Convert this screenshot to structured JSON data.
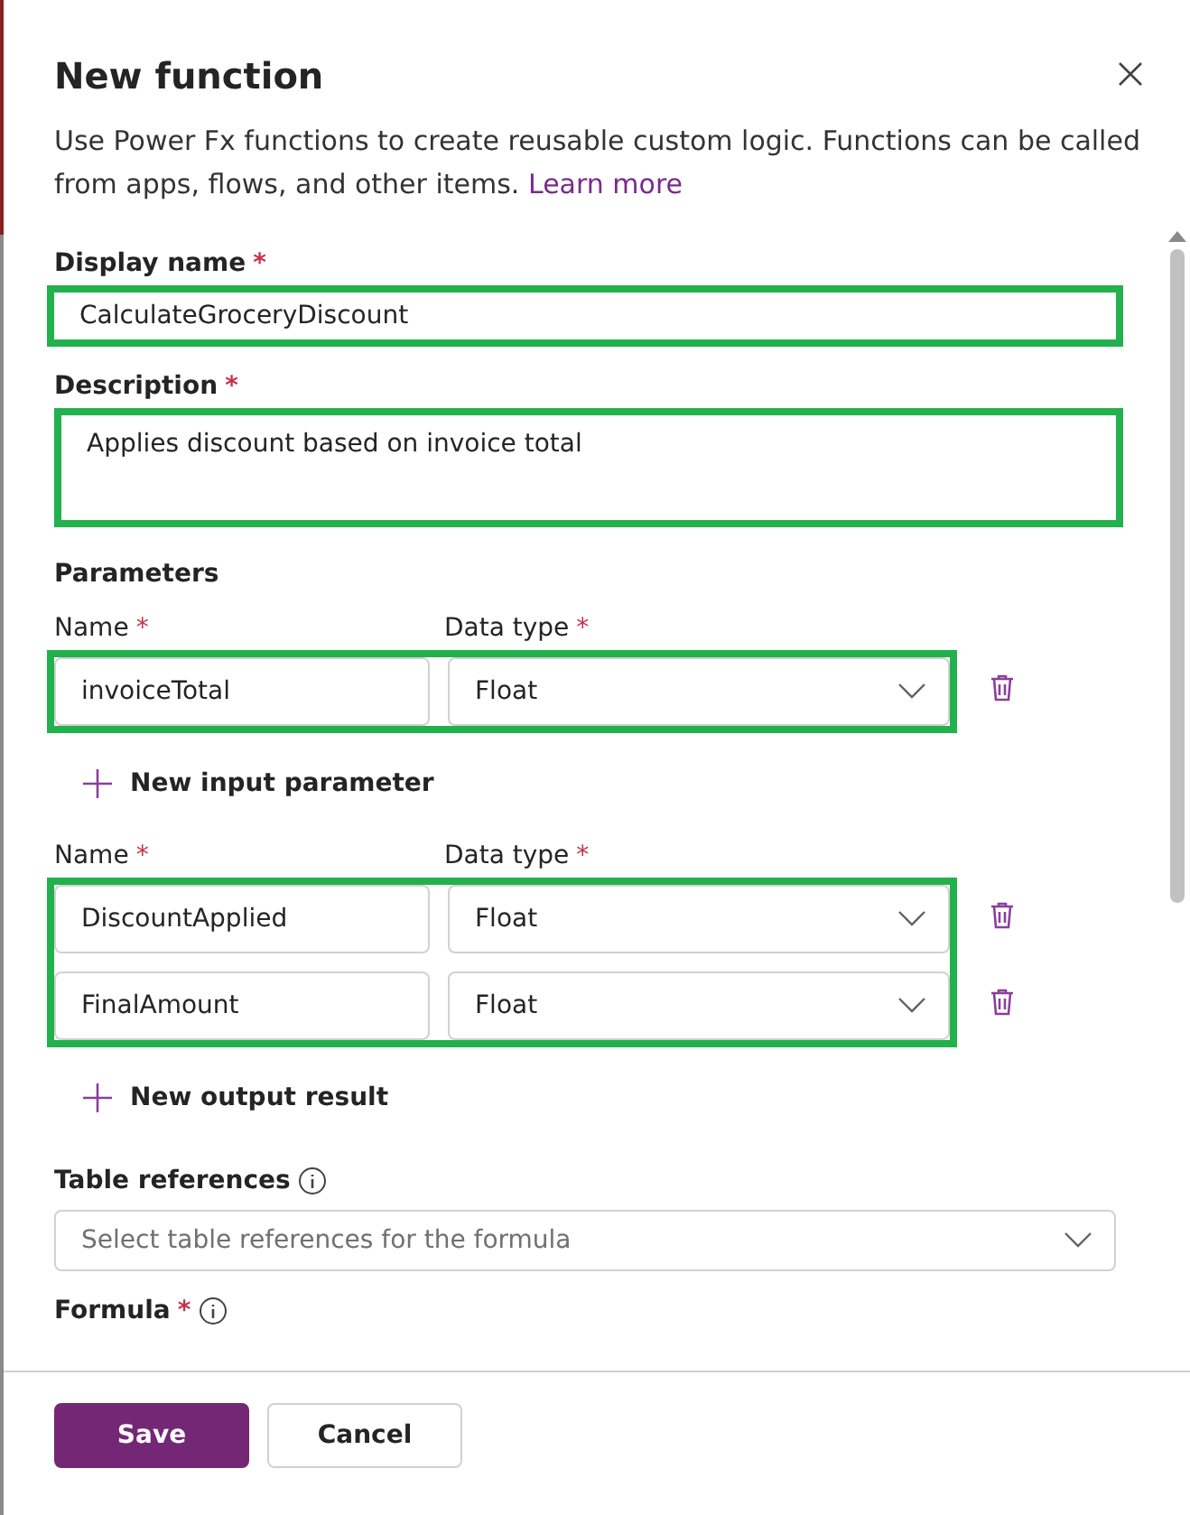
{
  "dialog": {
    "title": "New function",
    "intro": "Use Power Fx functions to create reusable custom logic. Functions can be called from apps, flows, and other items.",
    "learn_more": "Learn more"
  },
  "display_name": {
    "label": "Display name",
    "required": "*",
    "value": "CalculateGroceryDiscount",
    "highlighted": true
  },
  "description": {
    "label": "Description",
    "required": "*",
    "value": "Applies discount based on invoice total",
    "highlighted": true
  },
  "parameters_heading": "Parameters",
  "input_parameters": {
    "name_label": "Name",
    "type_label": "Data type",
    "required": "*",
    "highlighted": true,
    "rows": [
      {
        "name": "invoiceTotal",
        "type": "Float"
      }
    ],
    "add_label": "New input parameter"
  },
  "output_results": {
    "name_label": "Name",
    "type_label": "Data type",
    "required": "*",
    "highlighted": true,
    "rows": [
      {
        "name": "DiscountApplied",
        "type": "Float"
      },
      {
        "name": "FinalAmount",
        "type": "Float"
      }
    ],
    "add_label": "New output result"
  },
  "table_references": {
    "label": "Table references",
    "placeholder": "Select table references for the formula"
  },
  "formula": {
    "label": "Formula",
    "required": "*"
  },
  "buttons": [
    {
      "label": "Save",
      "kind": "primary"
    },
    {
      "label": "Cancel",
      "kind": "secondary"
    }
  ]
}
